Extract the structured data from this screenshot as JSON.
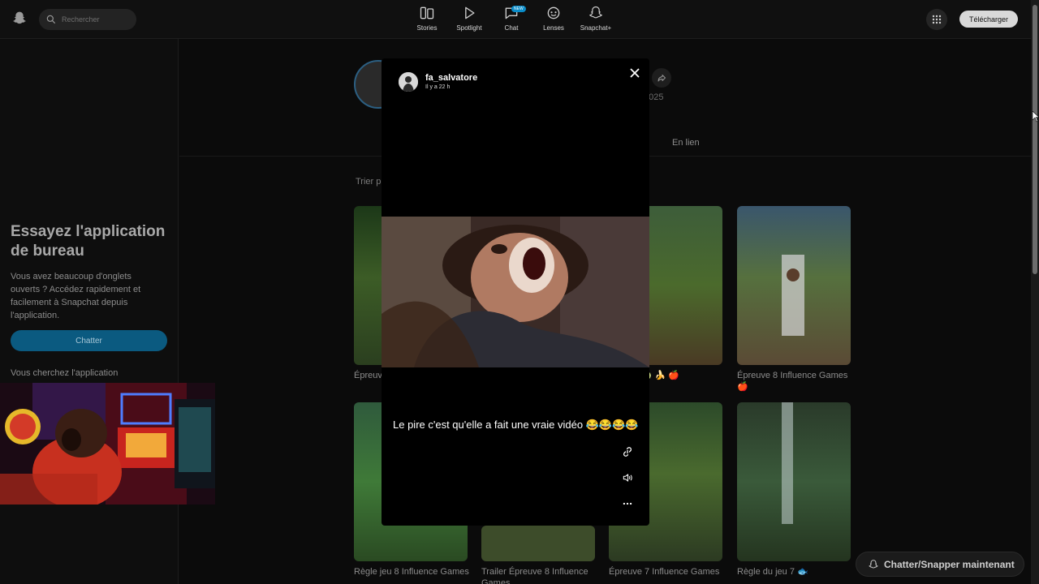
{
  "topbar": {
    "search_placeholder": "Rechercher",
    "nav": [
      {
        "label": "Stories",
        "icon": "stories-icon"
      },
      {
        "label": "Spotlight",
        "icon": "spotlight-icon"
      },
      {
        "label": "Chat",
        "icon": "chat-icon",
        "badge": "NEW"
      },
      {
        "label": "Lenses",
        "icon": "lenses-icon"
      },
      {
        "label": "Snapchat+",
        "icon": "snapchat-plus-icon"
      }
    ],
    "download_label": "Télécharger"
  },
  "sidebar": {
    "promo_title": "Essayez l'application de bureau",
    "promo_text": "Vous avez beaucoup d'onglets ouverts ? Accédez rapidement et facilement à Snapchat depuis l'application.",
    "chat_button": "Chatter",
    "promo_more": "Vous cherchez l'application"
  },
  "profile": {
    "date_fragment": "2025",
    "tab_link": "En lien",
    "sort_label": "Trier p"
  },
  "grid": {
    "captions": [
      "Épreuve",
      "reuve 9 🍈 🍌 🍎",
      "Épreuve 8 Influence Games 🍎",
      "Règle jeu 8 Influence Games",
      "Trailer Épreuve 8 Influence Games",
      "Épreuve 7 Influence Games",
      "Règle du jeu 7 🐟"
    ]
  },
  "modal": {
    "username": "fa_salvatore",
    "time": "Il y a 22 h",
    "caption": "Le pire c'est qu'elle a fait une vraie vidéo 😂😂😂😂"
  },
  "floating": {
    "label": "Chatter/Snapper maintenant"
  },
  "colors": {
    "accent": "#0b5a80",
    "background": "#0b0b0b",
    "modal": "#000000"
  }
}
